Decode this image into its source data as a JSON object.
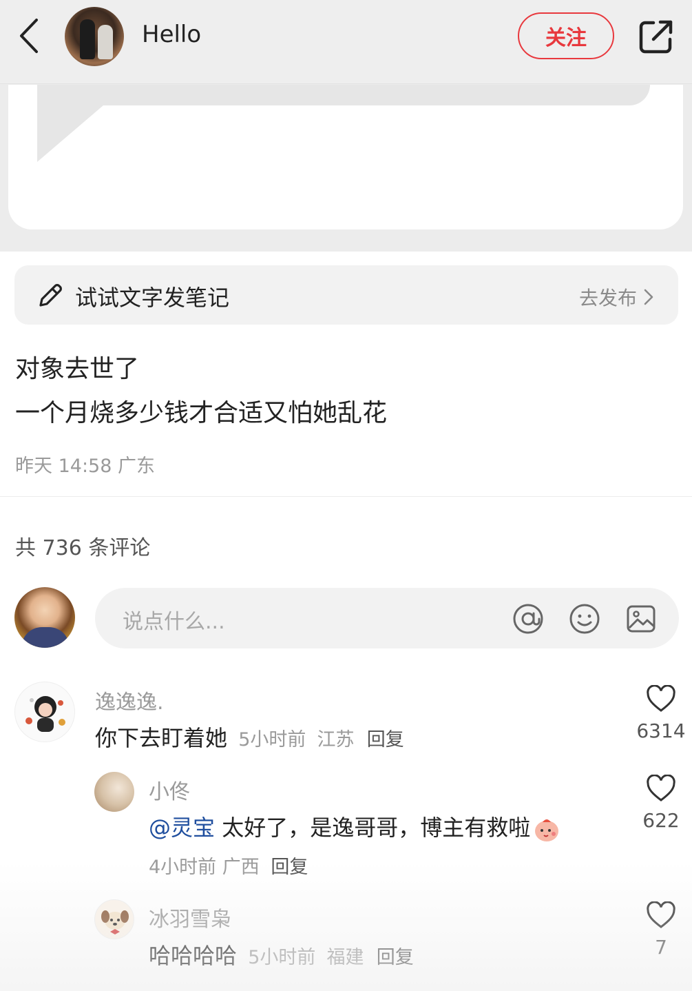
{
  "header": {
    "author_name": "Hello",
    "follow_label": "关注",
    "back_icon": "chevron-left-icon",
    "share_icon": "share-icon"
  },
  "publish_bar": {
    "title": "试试文字发笔记",
    "action": "去发布"
  },
  "post": {
    "line1": "对象去世了",
    "line2": "一个月烧多少钱才合适又怕她乱花",
    "time": "昨天 14:58",
    "location": "广东"
  },
  "comments_summary": {
    "count_text": "共 736 条评论"
  },
  "comment_input": {
    "placeholder": "说点什么..."
  },
  "comments": [
    {
      "name": "逸逸逸.",
      "text": "你下去盯着她",
      "time": "5小时前",
      "location": "江苏",
      "reply": "回复",
      "likes": "6314"
    },
    {
      "name": "小佟",
      "mention": "@灵宝",
      "text": "太好了，是逸哥哥，博主有救啦",
      "time": "4小时前",
      "location": "广西",
      "reply": "回复",
      "likes": "622"
    },
    {
      "name": "冰羽雪枭",
      "text": "哈哈哈哈",
      "time": "5小时前",
      "location": "福建",
      "reply": "回复",
      "likes": "7"
    }
  ],
  "colors": {
    "accent": "#e8383d",
    "mention": "#1f4e9e",
    "muted": "#9a9a9a"
  }
}
